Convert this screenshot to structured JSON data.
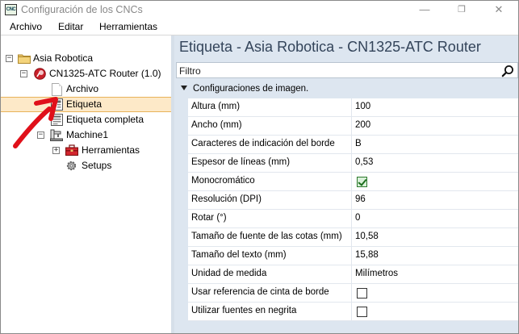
{
  "window": {
    "title": "Configuración de los CNCs",
    "app_icon_text": "CNC",
    "controls": {
      "minimize": "—",
      "maximize": "❐",
      "close": "✕"
    }
  },
  "menu": {
    "items": [
      {
        "label": "Archivo"
      },
      {
        "label": "Editar"
      },
      {
        "label": "Herramientas"
      }
    ]
  },
  "tree": {
    "root": {
      "label": "Asia Robotica",
      "expander": "−"
    },
    "machine": {
      "label": "CN1325-ATC Router (1.0)",
      "expander": "−"
    },
    "archivo": {
      "label": "Archivo"
    },
    "etiqueta": {
      "label": "Etiqueta",
      "selected": true
    },
    "etiqueta_completa": {
      "label": "Etiqueta completa"
    },
    "machine1": {
      "label": "Machine1",
      "expander": "−"
    },
    "herramientas": {
      "label": "Herramientas",
      "expander": "+"
    },
    "setups": {
      "label": "Setups"
    }
  },
  "panel": {
    "title": "Etiqueta - Asia Robotica - CN1325-ATC Router",
    "filter": {
      "placeholder": "Filtro",
      "value": ""
    },
    "group": {
      "label": "Configuraciones de imagen."
    },
    "properties": [
      {
        "name": "Altura (mm)",
        "value": "100"
      },
      {
        "name": "Ancho (mm)",
        "value": "200"
      },
      {
        "name": "Caracteres de indicación del borde",
        "value": "B"
      },
      {
        "name": "Espesor de líneas (mm)",
        "value": "0,53"
      },
      {
        "name": "Monocromático",
        "checkbox": true,
        "checked": true
      },
      {
        "name": "Resolución (DPI)",
        "value": "96"
      },
      {
        "name": "Rotar (°)",
        "value": "0"
      },
      {
        "name": "Tamaño de fuente de las cotas (mm)",
        "value": "10,58"
      },
      {
        "name": "Tamaño del texto (mm)",
        "value": "15,88"
      },
      {
        "name": "Unidad de medida",
        "value": "Milímetros"
      },
      {
        "name": "Usar referencia de cinta de borde",
        "checkbox": true,
        "checked": false
      },
      {
        "name": "Utilizar fuentes en negrita",
        "checkbox": true,
        "checked": false
      }
    ]
  },
  "colors": {
    "selection_bg": "#fde9c8",
    "selection_border": "#e8b25a",
    "panel_bg": "#dde6f0",
    "title_text": "#33445a",
    "annotation_arrow": "#e0101a"
  }
}
